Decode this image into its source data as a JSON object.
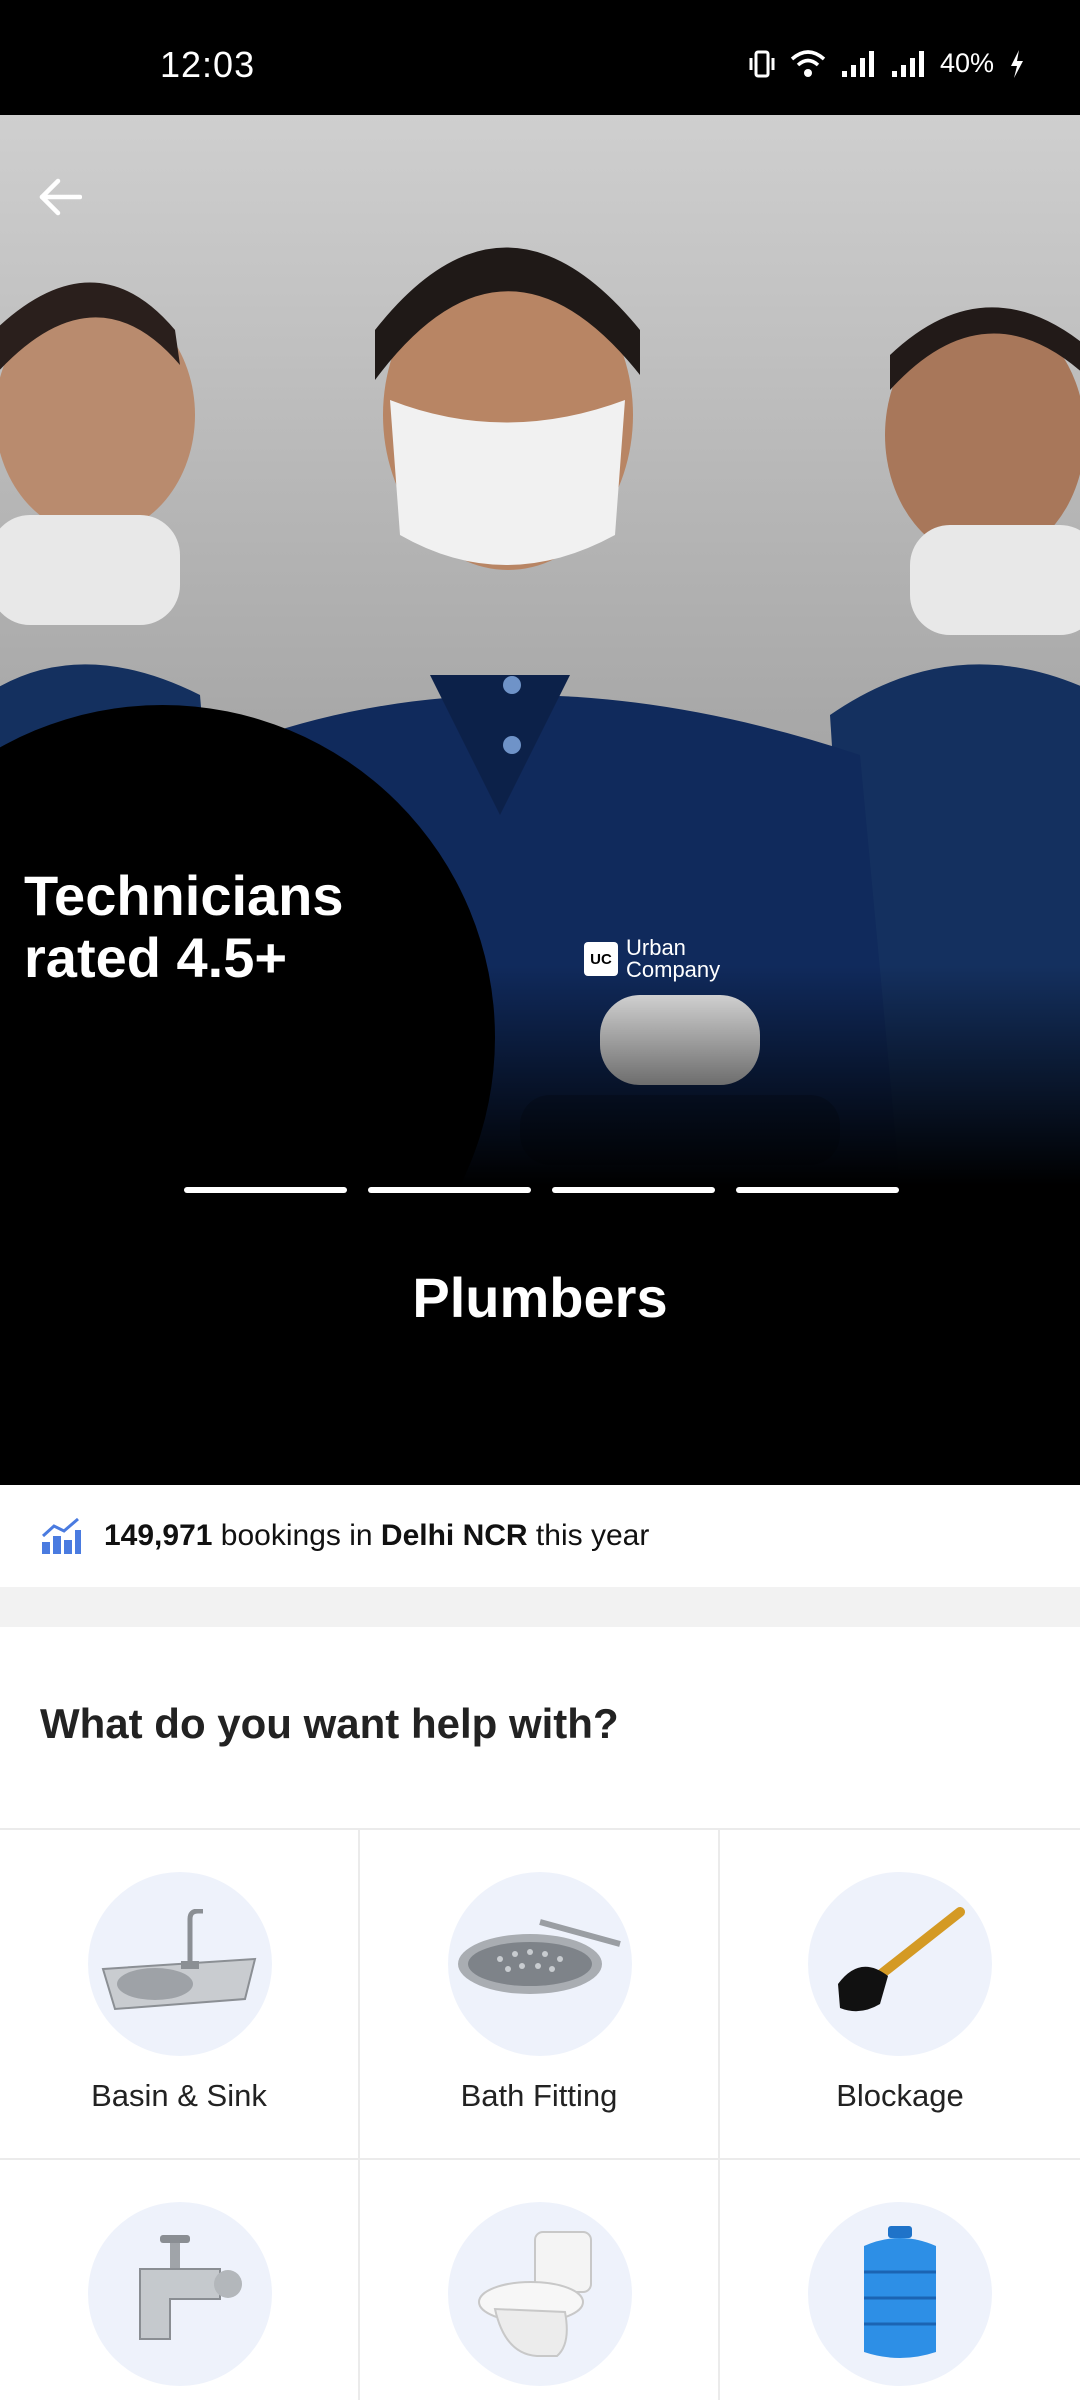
{
  "status_bar": {
    "time": "12:03",
    "battery": "40%",
    "icons": [
      "vibrate-icon",
      "wifi-icon",
      "signal-icon",
      "signal-icon",
      "charging-icon"
    ]
  },
  "hero": {
    "promo": "Technicians rated 4.5+",
    "brand_line1": "Urban",
    "brand_line2": "Company",
    "brand_mark": "UC",
    "title": "Plumbers",
    "carousel_total": 4
  },
  "stats": {
    "count": "149,971",
    "middle": " bookings in ",
    "city": "Delhi NCR",
    "suffix": " this year"
  },
  "help": {
    "heading": "What do you want help with?",
    "items": [
      {
        "label": "Basin & Sink",
        "icon": "sink-icon"
      },
      {
        "label": "Bath Fitting",
        "icon": "shower-head-icon"
      },
      {
        "label": "Blockage",
        "icon": "plunger-icon"
      },
      {
        "label": "",
        "icon": "tap-icon"
      },
      {
        "label": "",
        "icon": "toilet-icon"
      },
      {
        "label": "",
        "icon": "water-tank-icon"
      }
    ]
  },
  "colors": {
    "accent_chart": "#4a7be0",
    "icon_bg": "#eef2fb",
    "uniform": "#102a5c"
  }
}
